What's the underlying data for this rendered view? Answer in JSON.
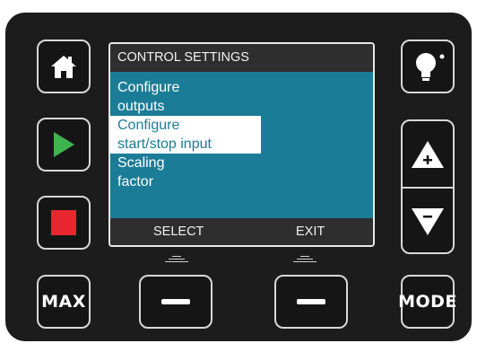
{
  "screen": {
    "title": "CONTROL SETTINGS",
    "menu": [
      {
        "line1": "Configure",
        "line2": "outputs",
        "selected": false
      },
      {
        "line1": "Configure",
        "line2": "start/stop input",
        "selected": true
      },
      {
        "line1": "Scaling",
        "line2": "factor",
        "selected": false
      }
    ],
    "softkeys": {
      "left": "SELECT",
      "right": "EXIT"
    }
  },
  "buttons": {
    "max_label": "MAX",
    "mode_label": "MODE"
  },
  "icons": {
    "home": "home-icon",
    "play": "play-icon",
    "stop": "stop-icon",
    "light": "lightbulb-icon",
    "up": "up-arrow-plus-icon",
    "down": "down-arrow-minus-icon"
  },
  "colors": {
    "screen_bg": "#1b7c97",
    "play": "#3fb34f",
    "stop": "#e8262f",
    "panel": "#1c1c1c"
  }
}
